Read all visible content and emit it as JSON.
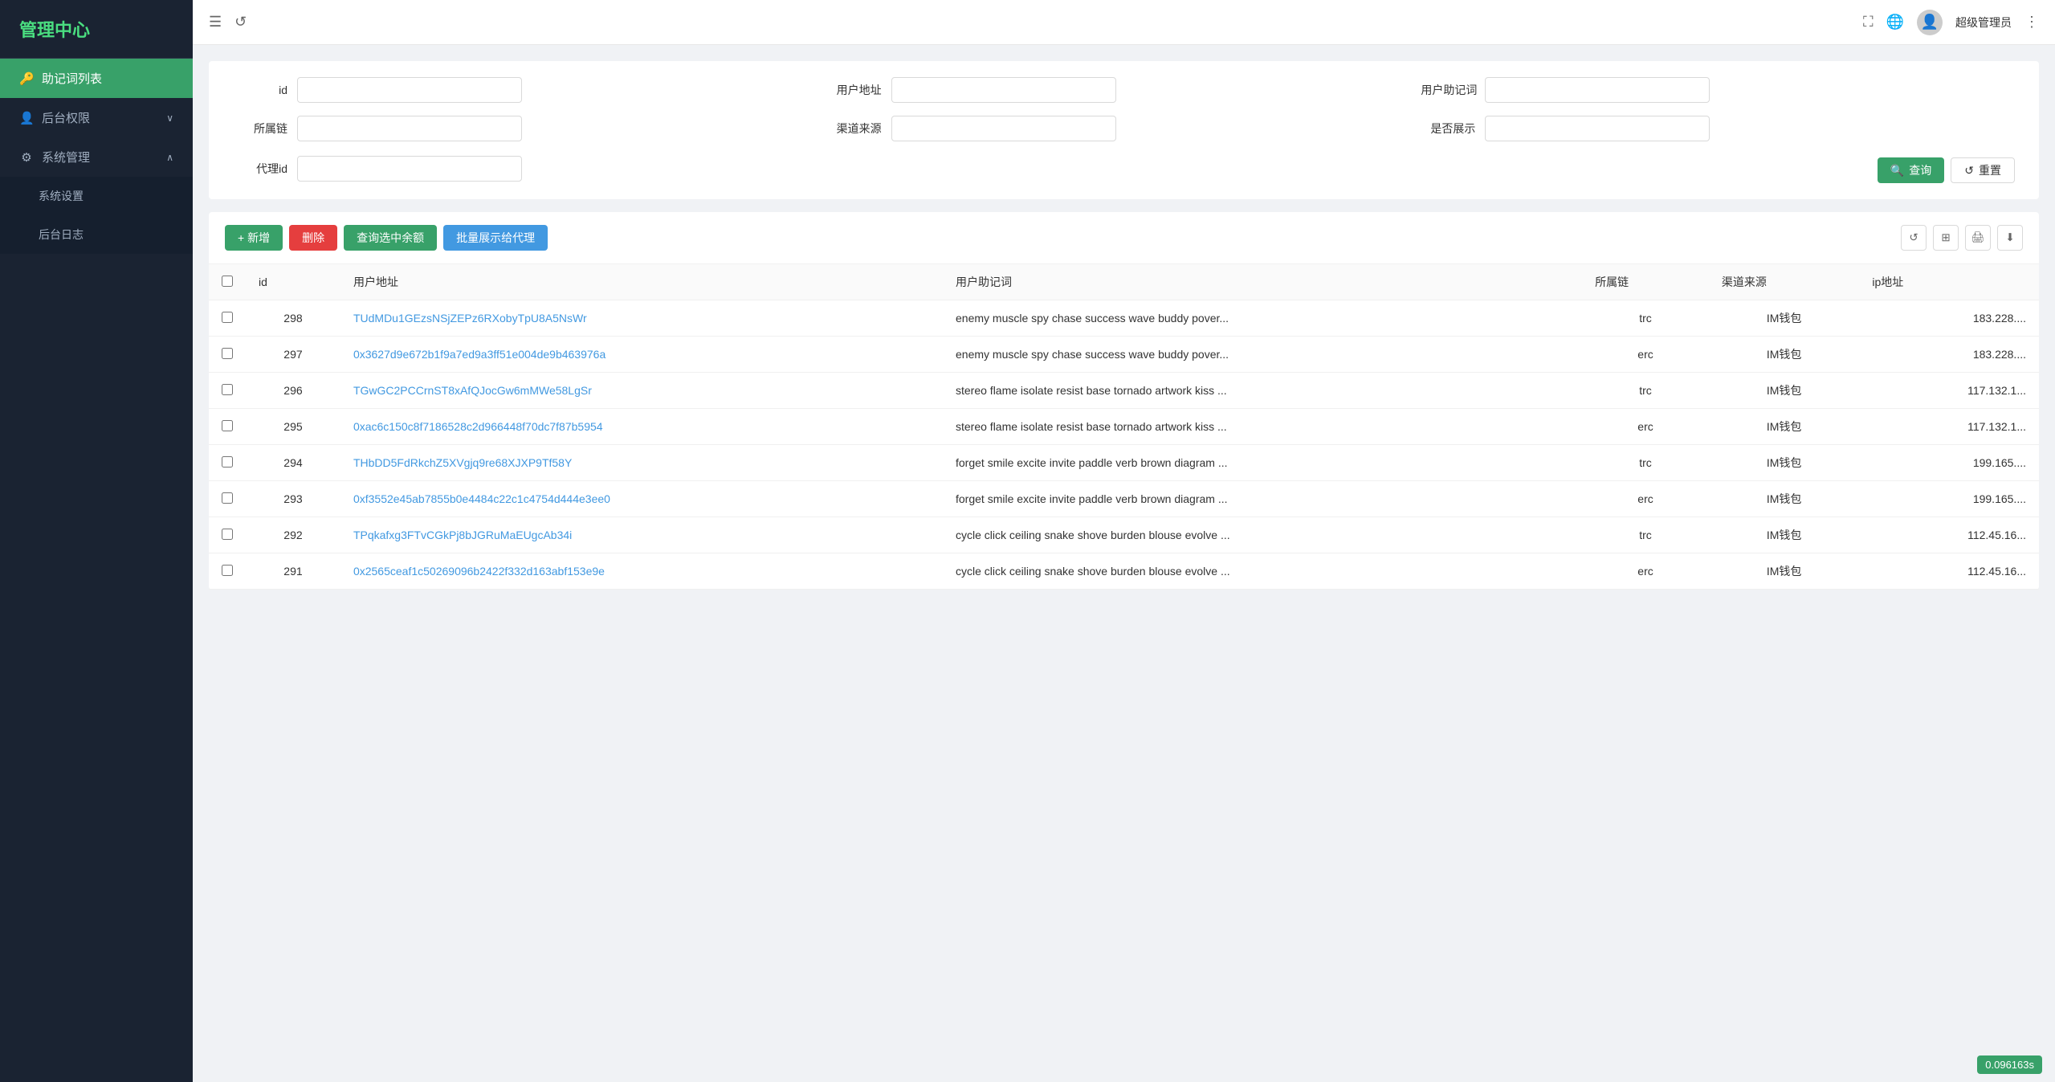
{
  "sidebar": {
    "logo": "管理中心",
    "items": [
      {
        "id": "mnemonic-list",
        "label": "助记词列表",
        "icon": "🔑",
        "active": true,
        "submenu": false
      },
      {
        "id": "backend-permissions",
        "label": "后台权限",
        "icon": "👤",
        "active": false,
        "submenu": true,
        "expanded": false
      },
      {
        "id": "system-management",
        "label": "系统管理",
        "icon": "⚙",
        "active": false,
        "submenu": true,
        "expanded": true
      }
    ],
    "submenu_items": [
      {
        "id": "system-settings",
        "label": "系统设置",
        "parent": "system-management"
      },
      {
        "id": "backend-log",
        "label": "后台日志",
        "parent": "system-management"
      }
    ]
  },
  "header": {
    "username": "超级管理员",
    "more_icon": "⋮"
  },
  "filter": {
    "fields": [
      {
        "id": "id-field",
        "label": "id",
        "placeholder": ""
      },
      {
        "id": "user-address-field",
        "label": "用户地址",
        "placeholder": ""
      },
      {
        "id": "user-mnemonic-field",
        "label": "用户助记词",
        "placeholder": ""
      },
      {
        "id": "chain-field",
        "label": "所属链",
        "placeholder": ""
      },
      {
        "id": "channel-field",
        "label": "渠道来源",
        "placeholder": ""
      },
      {
        "id": "display-field",
        "label": "是否展示",
        "placeholder": ""
      },
      {
        "id": "agent-id-field",
        "label": "代理id",
        "placeholder": ""
      }
    ],
    "search_btn": "查询",
    "reset_btn": "重置"
  },
  "toolbar": {
    "add_btn": "+ 新增",
    "delete_btn": "删除",
    "query_balance_btn": "查询选中余额",
    "batch_display_btn": "批量展示给代理"
  },
  "table": {
    "columns": [
      "id",
      "用户地址",
      "用户助记词",
      "所属链",
      "渠道来源",
      "ip地址"
    ],
    "rows": [
      {
        "id": "298",
        "address": "TUdMDu1GEzsNSjZEPz6RXobyTpU8A5NsWr",
        "mnemonic": "enemy muscle spy chase success wave buddy pover...",
        "chain": "trc",
        "source": "IM钱包",
        "ip": "183.228...."
      },
      {
        "id": "297",
        "address": "0x3627d9e672b1f9a7ed9a3ff51e004de9b463976a",
        "mnemonic": "enemy muscle spy chase success wave buddy pover...",
        "chain": "erc",
        "source": "IM钱包",
        "ip": "183.228...."
      },
      {
        "id": "296",
        "address": "TGwGC2PCCrnST8xAfQJocGw6mMWe58LgSr",
        "mnemonic": "stereo flame isolate resist base tornado artwork kiss ...",
        "chain": "trc",
        "source": "IM钱包",
        "ip": "117.132.1..."
      },
      {
        "id": "295",
        "address": "0xac6c150c8f7186528c2d966448f70dc7f87b5954",
        "mnemonic": "stereo flame isolate resist base tornado artwork kiss ...",
        "chain": "erc",
        "source": "IM钱包",
        "ip": "117.132.1..."
      },
      {
        "id": "294",
        "address": "THbDD5FdRkchZ5XVgjq9re68XJXP9Tf58Y",
        "mnemonic": "forget smile excite invite paddle verb brown diagram ...",
        "chain": "trc",
        "source": "IM钱包",
        "ip": "199.165...."
      },
      {
        "id": "293",
        "address": "0xf3552e45ab7855b0e4484c22c1c4754d444e3ee0",
        "mnemonic": "forget smile excite invite paddle verb brown diagram ...",
        "chain": "erc",
        "source": "IM钱包",
        "ip": "199.165...."
      },
      {
        "id": "292",
        "address": "TPqkafxg3FTvCGkPj8bJGRuMaEUgcAb34i",
        "mnemonic": "cycle click ceiling snake shove burden blouse evolve ...",
        "chain": "trc",
        "source": "IM钱包",
        "ip": "112.45.16..."
      },
      {
        "id": "291",
        "address": "0x2565ceaf1c50269096b2422f332d163abf153e9e",
        "mnemonic": "cycle click ceiling snake shove burden blouse evolve ...",
        "chain": "erc",
        "source": "IM钱包",
        "ip": "112.45.16..."
      }
    ]
  },
  "badge": {
    "value": "0.096163s"
  }
}
